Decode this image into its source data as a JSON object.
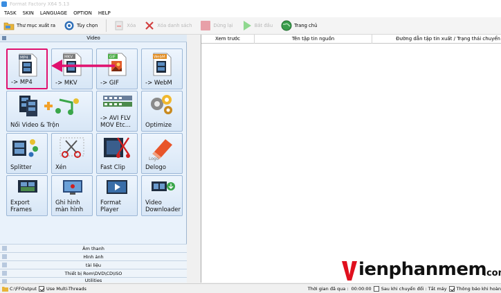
{
  "window": {
    "title": "Format Factory X64 5.13"
  },
  "menu": [
    "TASK",
    "SKIN",
    "LANGUAGE",
    "OPTION",
    "HELP"
  ],
  "toolbar": {
    "output_folder": "Thư mục xuất ra",
    "options": "Tùy chọn",
    "remove": "Xóa",
    "clear_list": "Xóa danh sách",
    "stop": "Dừng lại",
    "start": "Bắt đầu",
    "home": "Trang chủ"
  },
  "left_panel": {
    "section_title": "Video",
    "buttons": [
      {
        "label": "-> MP4",
        "icon": "mp4-file-icon",
        "badge": "MP4",
        "highlighted": true
      },
      {
        "label": "-> MKV",
        "icon": "mkv-file-icon",
        "badge": "MKV"
      },
      {
        "label": "-> GIF",
        "icon": "gif-file-icon",
        "badge": "GIF"
      },
      {
        "label": "-> WebM",
        "icon": "webm-file-icon",
        "badge": "WebM"
      },
      {
        "label": "Nối Video & Trộn",
        "icon": "join-video-music-icon"
      },
      {
        "label": "-> AVI FLV\nMOV Etc...",
        "icon": "film-strips-icon"
      },
      {
        "label": "Optimize",
        "icon": "gears-optimize-icon"
      },
      {
        "label": "Splitter",
        "icon": "film-split-icon"
      },
      {
        "label": "Xén",
        "icon": "scissors-crop-icon"
      },
      {
        "label": "Fast Clip",
        "icon": "fast-clip-icon"
      },
      {
        "label": "Delogo",
        "icon": "eraser-logo-icon"
      },
      {
        "label": "Export\nFrames",
        "icon": "export-frames-icon"
      },
      {
        "label": "Ghi hình\nmàn hình",
        "icon": "screen-record-icon"
      },
      {
        "label": "Format\nPlayer",
        "icon": "format-player-icon"
      },
      {
        "label": "Video\nDownloader",
        "icon": "video-downloader-icon"
      }
    ],
    "categories": [
      "Âm thanh",
      "Hình ảnh",
      "tài liệu",
      "Thiết bị Rom\\DVD\\CD\\ISO",
      "Utilities"
    ]
  },
  "file_list": {
    "columns": [
      "Xem trước",
      "Tên tập tin nguồn",
      "Đường dẫn tập tin xuất / Trạng thái chuyển"
    ]
  },
  "status_bar": {
    "output_path": "C:\\FFOutput",
    "multi_threads_label": "Use Multi-Threads",
    "multi_threads_checked": true,
    "elapsed_label": "Thời gian đã qua :",
    "elapsed_value": "00:00:00",
    "after_convert_label": "Sau khi chuyển đổi :",
    "after_convert_value": "Tắt máy",
    "after_convert_checked": false,
    "notify_label": "Thông báo khi hoàn",
    "notify_checked": true
  },
  "watermark": {
    "brand_v": "V",
    "brand_text": "ienphanmem",
    "brand_tld": ".com"
  },
  "colors": {
    "highlight": "#e0106e",
    "watermark_red": "#e0101e",
    "panel_bg": "#e9f2fb"
  }
}
